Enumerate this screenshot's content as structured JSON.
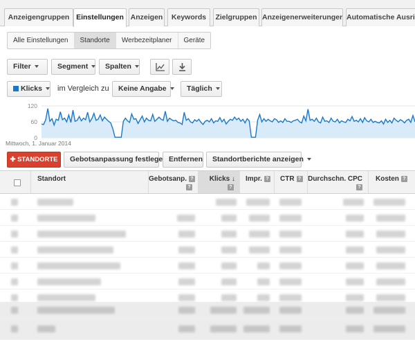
{
  "tabs": [
    "Anzeigengruppen",
    "Einstellungen",
    "Anzeigen",
    "Keywords",
    "Zielgruppen",
    "Anzeigenerweiterungen",
    "Automatische Ausrich"
  ],
  "active_tab": "Einstellungen",
  "subtabs": [
    "Alle Einstellungen",
    "Standorte",
    "Werbezeitplaner",
    "Geräte"
  ],
  "active_subtab": "Standorte",
  "toolbar": {
    "filter": "Filter",
    "segment": "Segment",
    "columns": "Spalten"
  },
  "chart_controls": {
    "metric": "Klicks",
    "compare_text": "im Vergleich zu",
    "compare_value": "Keine Angabe",
    "interval": "Täglich"
  },
  "chart_data": {
    "type": "line",
    "ylim": [
      0,
      120
    ],
    "yticks": [
      "120",
      "60",
      "0"
    ],
    "start_label": "Mittwoch, 1. Januar 2014",
    "series": [
      {
        "color": "#1a78c8",
        "values": [
          52,
          50,
          68,
          110,
          62,
          72,
          48,
          70,
          66,
          98,
          68,
          74,
          60,
          86,
          58,
          104,
          62,
          66,
          80,
          64,
          74,
          68,
          96,
          60,
          72,
          92,
          66,
          70,
          86,
          64,
          78,
          70,
          62,
          56,
          34,
          2,
          2,
          2,
          2,
          62,
          74,
          64,
          58,
          90,
          70,
          72,
          54,
          68,
          82,
          60,
          74,
          66,
          64,
          88,
          62,
          70,
          78,
          70,
          66,
          100,
          62,
          74,
          68,
          64,
          66,
          58,
          56,
          50,
          96,
          66,
          72,
          60,
          56,
          68,
          62,
          70,
          58,
          50,
          62,
          66,
          60,
          72,
          56,
          64,
          62,
          76,
          60,
          70,
          52,
          62,
          70,
          66,
          78,
          68,
          74,
          62,
          70,
          56,
          72,
          64,
          2,
          2,
          2,
          66,
          88,
          60,
          72,
          62,
          70,
          64,
          60,
          72,
          68,
          58,
          64,
          58,
          72,
          62,
          62,
          58,
          64,
          66,
          70,
          60,
          56,
          82,
          64,
          108,
          66,
          70,
          62,
          74,
          60,
          56,
          78,
          62,
          64,
          58,
          74,
          62,
          60,
          70,
          56,
          64,
          60,
          58,
          70,
          64,
          80,
          62,
          66,
          60,
          72,
          58,
          76,
          64,
          60,
          70,
          58,
          62,
          58,
          56,
          64,
          52,
          70,
          58,
          66,
          56,
          74,
          66,
          60,
          68,
          64,
          56,
          66,
          70,
          58,
          84,
          60
        ]
      }
    ]
  },
  "actions": {
    "add": "STANDORTE",
    "bid": "Gebotsanpassung festlegen",
    "remove": "Entfernen",
    "reports": "Standortberichte anzeigen"
  },
  "columns": {
    "location": "Standort",
    "bid_adj": "Gebotsanp.",
    "clicks": "Klicks",
    "impr": "Impr.",
    "ctr": "CTR",
    "avg_cpc": "Durchschn. CPC",
    "cost": "Kosten"
  },
  "help_glyph": "?",
  "sort_arrow": "↓",
  "plus_glyph": "✚",
  "colors": {
    "accent": "#1a78c8",
    "add_button": "#d9412e"
  }
}
